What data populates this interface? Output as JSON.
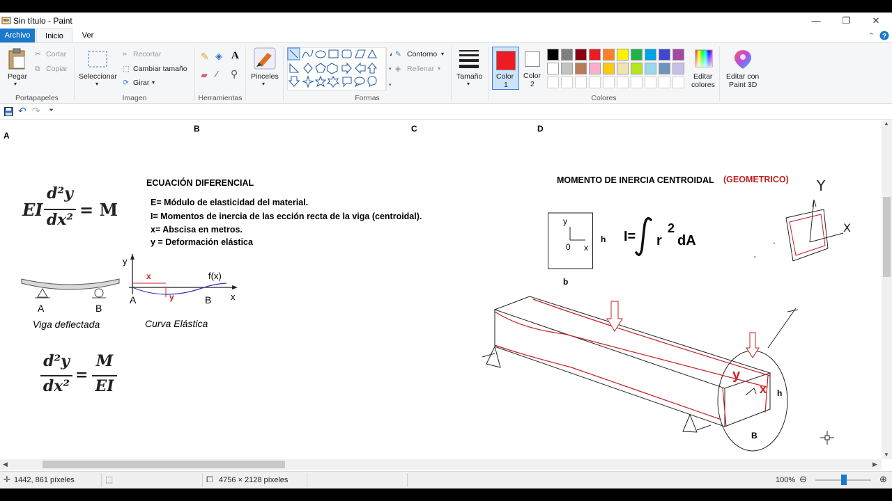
{
  "window": {
    "title": "Sin título - Paint",
    "minimize": "—",
    "restore": "❐",
    "close": "✕"
  },
  "tabs": {
    "file": "Archivo",
    "home": "Inicio",
    "view": "Ver"
  },
  "ribbon": {
    "clipboard": {
      "paste": "Pegar",
      "cut": "Cortar",
      "copy": "Copiar",
      "group": "Portapapeles"
    },
    "image": {
      "select": "Seleccionar",
      "crop": "Recortar",
      "resize": "Cambiar tamaño",
      "rotate": "Girar",
      "group": "Imagen"
    },
    "tools": {
      "group": "Herramientas"
    },
    "brushes": {
      "label": "Pinceles"
    },
    "shapes": {
      "outline": "Contorno",
      "fill": "Rellenar",
      "group": "Formas"
    },
    "size": {
      "label": "Tamaño"
    },
    "colors": {
      "color1": "Color",
      "color1_num": "1",
      "color2": "Color",
      "color2_num": "2",
      "edit": "Editar",
      "edit2": "colores",
      "group": "Colores",
      "paint3d": "Editar con",
      "paint3d2": "Paint 3D",
      "color1_value": "#ed1c24",
      "color2_value": "#ffffff",
      "palette_row1": [
        "#000000",
        "#7f7f7f",
        "#880015",
        "#ed1c24",
        "#ff7f27",
        "#fff200",
        "#22b14c",
        "#00a2e8",
        "#3f48cc",
        "#a349a4"
      ],
      "palette_row2": [
        "#ffffff",
        "#c3c3c3",
        "#b97a57",
        "#ffaec9",
        "#ffc90e",
        "#efe4b0",
        "#b5e61d",
        "#99d9ea",
        "#7092be",
        "#c8bfe7"
      ]
    }
  },
  "canvas": {
    "col_a": "A",
    "col_b": "B",
    "col_c": "C",
    "col_d": "D",
    "eq_title": "ECUACIÓN DIFERENCIAL",
    "def_e": "E=  Módulo de elasticidad del material.",
    "def_i": "I=  Momentos de inercia de las ección recta de la viga  (centroidal).",
    "def_x": "x=  Abscisa  en metros.",
    "def_y": "y = Deformación elástica",
    "eq1_lhs": "EI",
    "eq1_num": "d²y",
    "eq1_den": "dx²",
    "eq1_rhs": "= M",
    "eq2_num": "d²y",
    "eq2_den": "dx²",
    "eq2_eq": "=",
    "eq2_rnum": "M",
    "eq2_rden": "EI",
    "beam_a": "A",
    "beam_b": "B",
    "beam_caption": "Viga deflectada",
    "curve_y": "y",
    "curve_fx": "f(x)",
    "curve_x_red": "x",
    "curve_y_red": "y",
    "curve_a": "A",
    "curve_b": "B",
    "curve_x": "x",
    "curve_caption": "Curva Elástica",
    "moment_title": "MOMENTO DE INERCIA CENTROIDAL",
    "moment_geo": "(GEOMETRICO)",
    "box_y": "y",
    "box_0": "0",
    "box_x": "x",
    "box_h": "h",
    "box_b": "b",
    "integral_i": "I=",
    "integral_r": "r",
    "integral_2": "2",
    "integral_da": "dA",
    "sketch_y": "Y",
    "sketch_x": "X",
    "beam3d_y": "y",
    "beam3d_x": "x",
    "beam3d_h": "h",
    "beam3d_b": "B"
  },
  "status": {
    "cursor": "1442, 861 píxeles",
    "dimensions": "4756 × 2128 píxeles",
    "zoom": "100%"
  }
}
